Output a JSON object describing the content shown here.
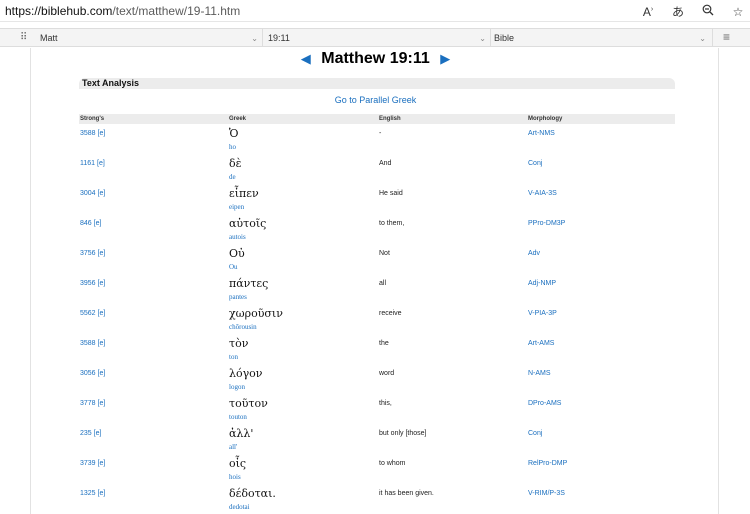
{
  "browser": {
    "url_host": "https://biblehub.com",
    "url_path": "/text/matthew/19-11.htm",
    "icons": [
      "read-aloud-icon",
      "translate-icon",
      "zoom-out-icon",
      "favorite-star-icon"
    ]
  },
  "nav": {
    "book": "Matt",
    "verse": "19:11",
    "version": "Bible"
  },
  "page": {
    "title": "Matthew 19:11",
    "prev_arrow": "◀",
    "next_arrow": "▶",
    "section_heading": "Text Analysis",
    "parallel_link": "Go to Parallel Greek"
  },
  "table": {
    "headers": [
      "Strong's",
      "Greek",
      "English",
      "Morphology"
    ],
    "rows": [
      {
        "strongs": "3588 [e]",
        "greek": "Ὁ",
        "translit": "ho",
        "english": "-",
        "morph": "Art-NMS"
      },
      {
        "strongs": "1161 [e]",
        "greek": "δὲ",
        "translit": "de",
        "english": "And",
        "morph": "Conj"
      },
      {
        "strongs": "3004 [e]",
        "greek": "εἶπεν",
        "translit": "eipen",
        "english": "He said",
        "morph": "V-AIA-3S"
      },
      {
        "strongs": "846 [e]",
        "greek": "αὐτοῖς",
        "translit": "autois",
        "english": "to them,",
        "morph": "PPro-DM3P"
      },
      {
        "strongs": "3756 [e]",
        "greek": "Οὐ",
        "translit": "Ou",
        "english": "Not",
        "morph": "Adv"
      },
      {
        "strongs": "3956 [e]",
        "greek": "πάντες",
        "translit": "pantes",
        "english": "all",
        "morph": "Adj-NMP"
      },
      {
        "strongs": "5562 [e]",
        "greek": "χωροῦσιν",
        "translit": "chōrousin",
        "english": "receive",
        "morph": "V-PIA-3P"
      },
      {
        "strongs": "3588 [e]",
        "greek": "τὸν",
        "translit": "ton",
        "english": "the",
        "morph": "Art-AMS"
      },
      {
        "strongs": "3056 [e]",
        "greek": "λόγον",
        "translit": "logon",
        "english": "word",
        "morph": "N-AMS"
      },
      {
        "strongs": "3778 [e]",
        "greek": "τοῦτον",
        "translit": "touton",
        "english": "this,",
        "morph": "DPro-AMS"
      },
      {
        "strongs": "235 [e]",
        "greek": "ἀλλ'",
        "translit": "all'",
        "english": "but only [those]",
        "morph": "Conj"
      },
      {
        "strongs": "3739 [e]",
        "greek": "οἷς",
        "translit": "hois",
        "english": "to whom",
        "morph": "RelPro-DMP"
      },
      {
        "strongs": "1325 [e]",
        "greek": "δέδοται.",
        "translit": "dedotai",
        "english": "it has been given.",
        "morph": "V-RIM/P-3S"
      }
    ]
  }
}
